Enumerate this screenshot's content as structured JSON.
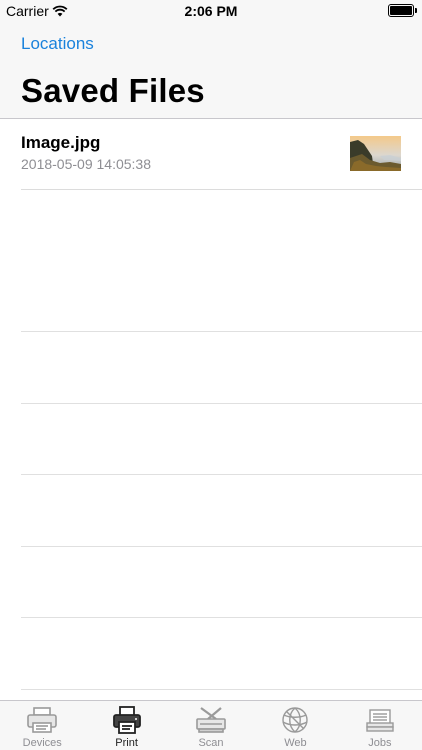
{
  "status_bar": {
    "carrier": "Carrier",
    "time": "2:06 PM"
  },
  "nav": {
    "back_label": "Locations",
    "title": "Saved Files"
  },
  "files": [
    {
      "name": "Image.jpg",
      "date": "2018-05-09 14:05:38",
      "thumbnail_icon": "landscape-photo-thumbnail"
    }
  ],
  "tab_bar": {
    "active": "Print",
    "tabs": [
      {
        "label": "Devices",
        "icon": "printer-device-icon"
      },
      {
        "label": "Print",
        "icon": "print-icon"
      },
      {
        "label": "Scan",
        "icon": "scanner-icon"
      },
      {
        "label": "Web",
        "icon": "globe-icon"
      },
      {
        "label": "Jobs",
        "icon": "jobs-stack-icon"
      }
    ]
  },
  "colors": {
    "accent": "#1a82dc",
    "secondary_text": "#8e8e93",
    "bar_bg": "#f7f7f7"
  }
}
